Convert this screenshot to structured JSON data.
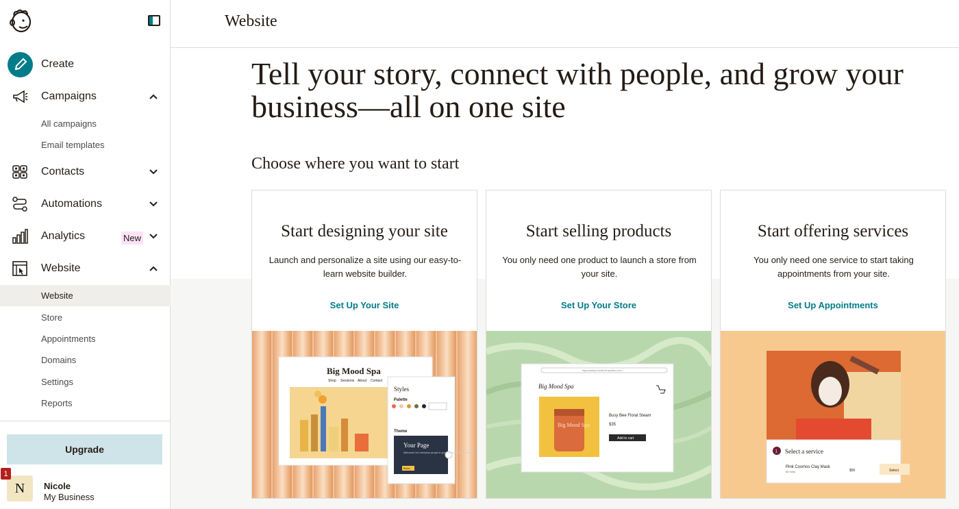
{
  "sidebar": {
    "create_label": "Create",
    "campaigns": {
      "label": "Campaigns",
      "items": [
        "All campaigns",
        "Email templates"
      ]
    },
    "contacts_label": "Contacts",
    "automations_label": "Automations",
    "analytics": {
      "label": "Analytics",
      "badge": "New"
    },
    "website": {
      "label": "Website",
      "items": [
        "Website",
        "Store",
        "Appointments",
        "Domains",
        "Settings",
        "Reports"
      ],
      "active": "Website"
    },
    "upgrade_label": "Upgrade",
    "user": {
      "initial": "N",
      "name": "Nicole",
      "business": "My Business",
      "notifications": "1"
    }
  },
  "header": {
    "title": "Website"
  },
  "main": {
    "hero": "Tell your story, connect with people, and grow your business—all on one site",
    "choose": "Choose where you want to start",
    "cards": [
      {
        "title": "Start designing your site",
        "desc": "Launch and personalize a site using our easy-to-learn website builder.",
        "link": "Set Up Your Site"
      },
      {
        "title": "Start selling products",
        "desc": "You only need one product to launch a store from your site.",
        "link": "Set Up Your Store"
      },
      {
        "title": "Start offering services",
        "desc": "You only need one service to start taking appointments from your site.",
        "link": "Set Up Appointments"
      }
    ]
  },
  "mock_site": {
    "brand": "Big Mood Spa",
    "nav": [
      "Shop",
      "Sessions",
      "About",
      "Contact"
    ],
    "styles_panel": {
      "title": "Styles",
      "palette_label": "Palette",
      "theme_label": "Theme",
      "preview_title": "Your Page",
      "preview_text": "Welcome! Let's introduce people to your website and your business.",
      "preview_button": "Button"
    }
  },
  "mock_store": {
    "url": "bigmoodspa.mailchimpsites.com",
    "brand": "Big Mood Spa",
    "jar_text": "Big Mood Spa",
    "product": "Busy Bee Floral Steam",
    "price": "$35",
    "button": "Add to cart"
  },
  "mock_services": {
    "step": "1",
    "heading": "Select a service",
    "service": "Pink Cosmos Clay Mask",
    "duration": "60 mins",
    "price": "$50",
    "button": "Select"
  },
  "colors": {
    "accent": "#007c89",
    "upgrade_bg": "#cfe4e8",
    "new_badge": "#fbe3f7",
    "notification": "#b51e1e"
  }
}
